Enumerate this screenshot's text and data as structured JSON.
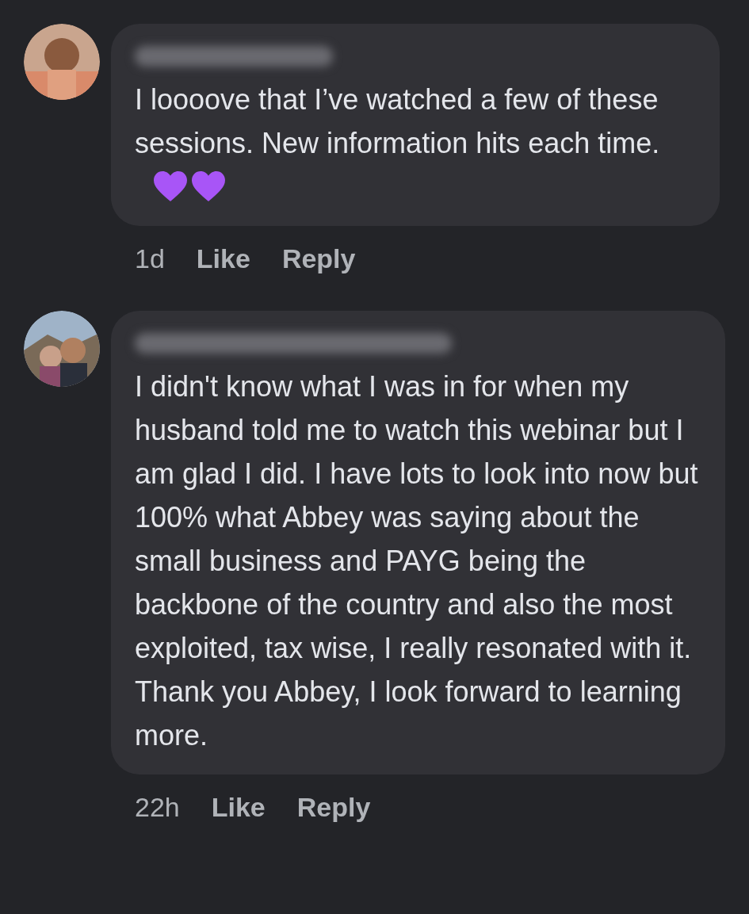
{
  "comments": [
    {
      "text": "I loooove that I’ve watched a few of these sessions. New information hits each time.",
      "trailing_icons": [
        {
          "kind": "heart"
        },
        {
          "kind": "heart"
        }
      ],
      "time": "1d",
      "actions": [
        "Like",
        "Reply"
      ]
    },
    {
      "text": "I didn't know what I was in for when my husband told me to watch this webinar but I am glad I did. I have lots to look into now but 100% what Abbey was saying about the small business and PAYG being the backbone of the country and also the most exploited, tax wise, I really resonated with it. Thank you Abbey, I look forward to learning more.",
      "time": "22h",
      "actions": [
        "Like",
        "Reply"
      ]
    }
  ]
}
